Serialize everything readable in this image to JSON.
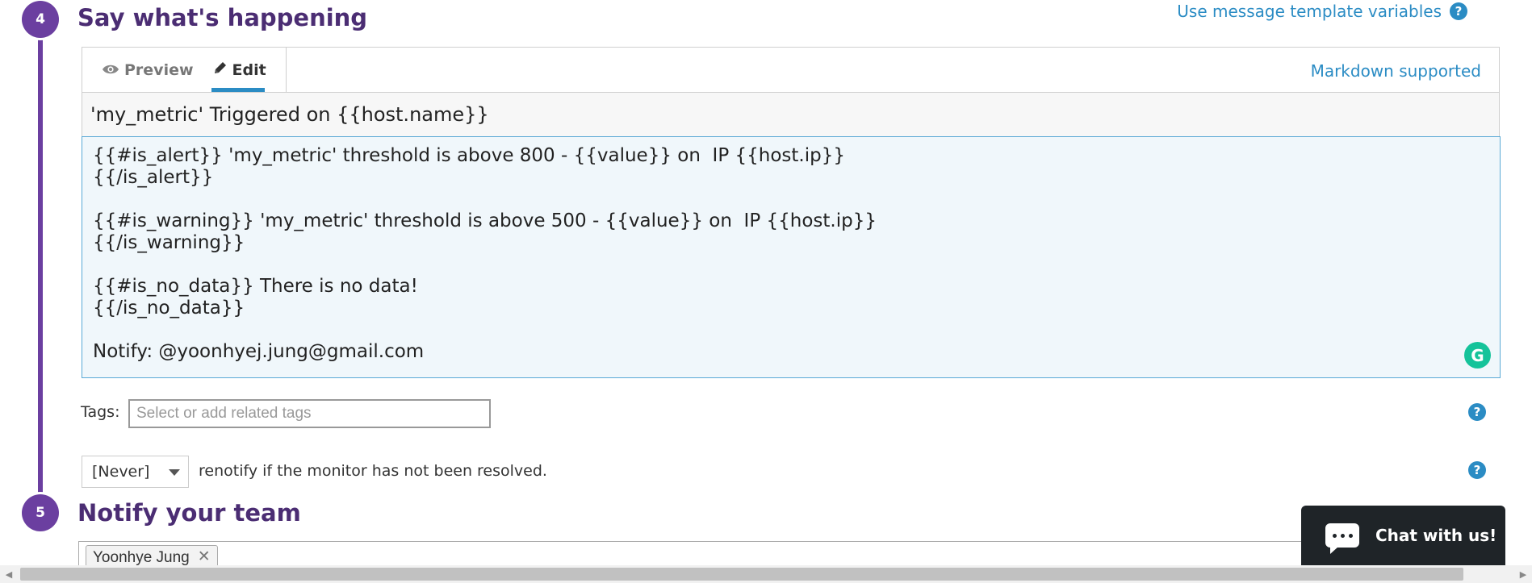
{
  "steps": {
    "say": {
      "number": "4",
      "title": "Say what's happening"
    },
    "notify": {
      "number": "5",
      "title": "Notify your team"
    }
  },
  "template_link": "Use message template variables",
  "editor": {
    "tabs": [
      {
        "label": "Preview",
        "icon": "eye-icon",
        "active": false
      },
      {
        "label": "Edit",
        "icon": "pencil-icon",
        "active": true
      }
    ],
    "markdown_link": "Markdown supported",
    "subject": "'my_metric' Triggered on {{host.name}}",
    "body": "{{#is_alert}} 'my_metric' threshold is above 800 - {{value}} on  IP {{host.ip}}\n{{/is_alert}}\n\n{{#is_warning}} 'my_metric' threshold is above 500 - {{value}} on  IP {{host.ip}}\n{{/is_warning}}\n\n{{#is_no_data}} There is no data!\n{{/is_no_data}}\n\nNotify: @yoonhyej.jung@gmail.com"
  },
  "tags": {
    "label": "Tags:",
    "placeholder": "Select or add related tags"
  },
  "renotify": {
    "selected": "[Never]",
    "text": "renotify if the monitor has not been resolved."
  },
  "team": {
    "chips": [
      "Yoonhye Jung"
    ]
  },
  "chat": {
    "label": "Chat with us!"
  },
  "colors": {
    "accent_purple": "#6b3fa0",
    "title_purple": "#4b2d73",
    "link_blue": "#2b8cc4",
    "grammarly_green": "#15c39a",
    "chat_bg": "#1f2428"
  }
}
